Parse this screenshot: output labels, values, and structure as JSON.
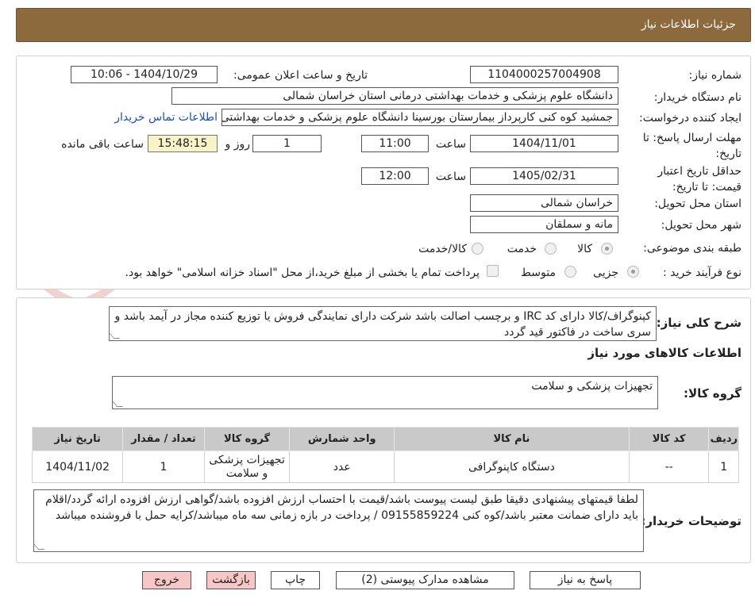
{
  "header": {
    "title": "جزئیات اطلاعات نیاز"
  },
  "form": {
    "need_number_label": "شماره نیاز:",
    "need_number": "1104000257004908",
    "announce_label": "تاریخ و ساعت اعلان عمومی:",
    "announce_value": "1404/10/29 - 10:06",
    "buyer_label": "نام دستگاه خریدار:",
    "buyer_value": "دانشگاه علوم پزشکی و خدمات بهداشتی درمانی استان خراسان شمالی",
    "creator_label": "ایجاد کننده درخواست:",
    "creator_value": "جمشید کوه کنی کارپرداز بیمارستان بورسینا دانشگاه علوم پزشکی و خدمات بهداشتی",
    "contact_link": "اطلاعات تماس خریدار",
    "reply_deadline_label": "مهلت ارسال پاسخ: تا تاریخ:",
    "reply_date": "1404/11/01",
    "time_label": "ساعت",
    "reply_time": "11:00",
    "days_value": "1",
    "days_label": "روز و",
    "remaining_time": "15:48:15",
    "remaining_label": "ساعت باقی مانده",
    "validity_label": "حداقل تاریخ اعتبار قیمت: تا تاریخ:",
    "validity_date": "1405/02/31",
    "validity_time_label": "ساعت",
    "validity_time": "12:00",
    "province_label": "استان محل تحویل:",
    "province_value": "خراسان شمالی",
    "city_label": "شهر محل تحویل:",
    "city_value": "مانه و سملقان",
    "category_label": "طبقه بندی موضوعی:",
    "category_options": [
      "کالا",
      "خدمت",
      "کالا/خدمت"
    ],
    "process_label": "نوع فرآیند خرید :",
    "process_options": [
      "جزیی",
      "متوسط"
    ],
    "payment_note": "پرداخت تمام یا بخشی از مبلغ خرید،از محل \"اسناد خزانه اسلامی\" خواهد بود."
  },
  "description": {
    "label": "شرح کلی نیاز:",
    "text": "کپنوگراف/کالا دارای کد IRC و برچسب اصالت باشد شرکت دارای نمایندگی فروش یا توزیع کننده  مجاز در آیمد باشد و سری ساخت در فاکتور قید گردد",
    "goods_info_title": "اطلاعات کالاهای مورد نیاز",
    "goods_group_label": "گروه کالا:",
    "goods_group_value": "تجهیزات پزشکی و سلامت"
  },
  "table": {
    "headers": [
      "ردیف",
      "کد کالا",
      "نام کالا",
      "واحد شمارش",
      "گروه کالا",
      "تعداد / مقدار",
      "تاریخ نیاز"
    ],
    "rows": [
      [
        "1",
        "--",
        "دستگاه کاپنوگرافی",
        "عدد",
        "تجهیزات پزشکی و سلامت",
        "1",
        "1404/11/02"
      ]
    ]
  },
  "buyer_notes": {
    "label": "توضیحات خریدار:",
    "text": "لطفا قیمتهای پیشنهادی دقیقا طبق لیست پیوست باشد/قیمت با احتساب ارزش افزوده باشد/گواهی ارزش افزوده ارائه گردد/اقلام باید دارای ضمانت معتبر باشد/کوه کنی 09155859224 / پرداخت در بازه زمانی سه ماه میباشد/کرایه حمل با فروشنده میباشد"
  },
  "buttons": {
    "reply": "پاسخ به نیاز",
    "attachments": "مشاهده مدارک پیوستی (2)",
    "print": "چاپ",
    "back": "بازگشت",
    "exit": "خروج"
  },
  "watermark": {
    "text": "AriaTender.neT"
  }
}
